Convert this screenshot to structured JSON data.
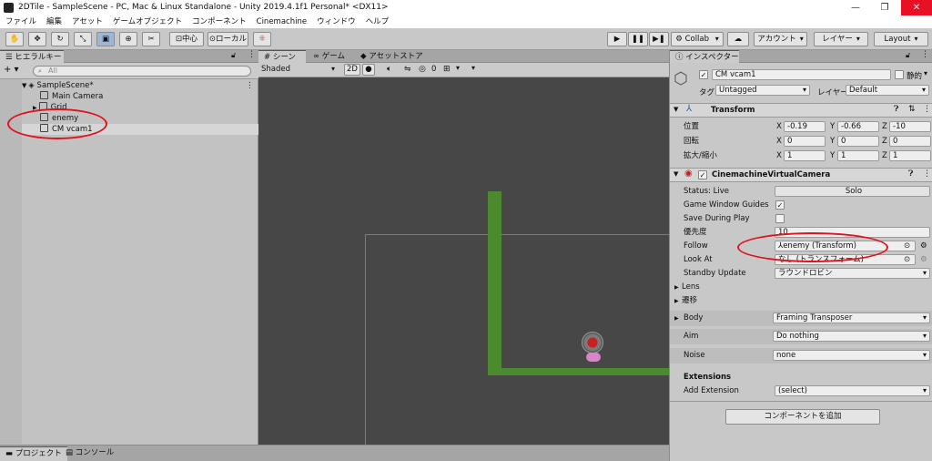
{
  "window": {
    "title": "2DTile - SampleScene - PC, Mac & Linux Standalone - Unity 2019.4.1f1 Personal* <DX11>",
    "minimize": "—",
    "maximize": "❐",
    "close": "✕"
  },
  "menu": [
    "ファイル",
    "編集",
    "アセット",
    "ゲームオブジェクト",
    "コンポーネント",
    "Cinemachine",
    "ウィンドウ",
    "ヘルプ"
  ],
  "toolbar": {
    "pivot": "中心",
    "space": "ローカル",
    "collab": "Collab",
    "account": "アカウント",
    "layers": "レイヤー",
    "layout": "Layout"
  },
  "hierarchy": {
    "tab": "ヒエラルキー",
    "add": "+ ▾",
    "search_placeholder": "All",
    "scene": "SampleScene*",
    "items": [
      "Main Camera",
      "Grid",
      "enemy",
      "CM vcam1"
    ]
  },
  "scene_view": {
    "tabs": [
      "シーン",
      "ゲーム",
      "アセットストア"
    ],
    "shading": "Shaded",
    "mode_2d": "2D",
    "gizmo_count": "0"
  },
  "inspector": {
    "tab": "インスペクター",
    "object_name": "CM vcam1",
    "static_label": "静的",
    "tag_label": "タグ",
    "tag_value": "Untagged",
    "layer_label": "レイヤー",
    "layer_value": "Default",
    "transform": {
      "title": "Transform",
      "position_label": "位置",
      "rotation_label": "回転",
      "scale_label": "拡大/縮小",
      "position": [
        "-0.19",
        "-0.66",
        "-10"
      ],
      "rotation": [
        "0",
        "0",
        "0"
      ],
      "scale": [
        "1",
        "1",
        "1"
      ]
    },
    "vcam": {
      "title": "CinemachineVirtualCamera",
      "status_label": "Status: Live",
      "solo": "Solo",
      "game_window_guides": "Game Window Guides",
      "save_during_play": "Save During Play",
      "priority_label": "優先度",
      "priority_value": "10",
      "follow_label": "Follow",
      "follow_value": "enemy (Transform)",
      "lookat_label": "Look At",
      "lookat_value": "なし (トランスフォーム)",
      "standby_label": "Standby Update",
      "standby_value": "ラウンドロビン",
      "lens": "Lens",
      "transition": "遷移",
      "body_label": "Body",
      "body_value": "Framing Transposer",
      "aim_label": "Aim",
      "aim_value": "Do nothing",
      "noise_label": "Noise",
      "noise_value": "none",
      "extensions": "Extensions",
      "add_extension_label": "Add Extension",
      "add_extension_value": "(select)"
    },
    "add_component": "コンポーネントを追加"
  },
  "bottom_tabs": [
    "プロジェクト",
    "コンソール"
  ],
  "colors": {
    "annotation": "#e0141e",
    "scene_bg": "#474747",
    "tile_green": "#4c8a2f",
    "camera_frame": "#d25a4a",
    "close_btn": "#e81123"
  }
}
